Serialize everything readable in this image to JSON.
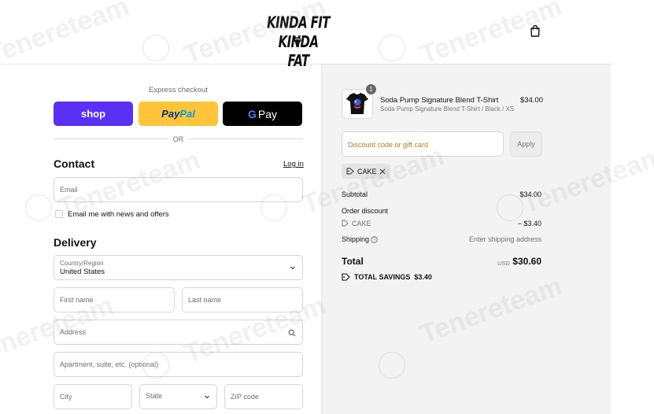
{
  "header": {
    "logo_text": "KINDA FIT KINDA FAT",
    "cart_icon": "shopping-bag-icon"
  },
  "express": {
    "title": "Express checkout",
    "shop_label": "shop",
    "paypal_label_1": "Pay",
    "paypal_label_2": "Pal",
    "gpay_g": "G",
    "gpay_label": "Pay",
    "or_label": "OR"
  },
  "contact": {
    "title": "Contact",
    "login_label": "Log in",
    "email_placeholder": "Email",
    "newsletter_label": "Email me with news and offers"
  },
  "delivery": {
    "title": "Delivery",
    "country_label": "Country/Region",
    "country_value": "United States",
    "first_name_placeholder": "First name",
    "last_name_placeholder": "Last name",
    "address_placeholder": "Address",
    "apartment_placeholder": "Apartment, suite, etc. (optional)",
    "city_placeholder": "City",
    "state_placeholder": "State",
    "zip_placeholder": "ZIP code"
  },
  "summary": {
    "product": {
      "quantity": "1",
      "name": "Soda Pump Signature Blend T-Shirt",
      "variant": "Soda Pump Signature Blend T-Shirt / Black / XS",
      "price": "$34.00"
    },
    "discount_placeholder": "Discount code or gift card",
    "apply_label": "Apply",
    "applied_code": "CAKE",
    "subtotal_label": "Subtotal",
    "subtotal_value": "$34.00",
    "order_discount_label": "Order discount",
    "discount_code": "CAKE",
    "discount_value": "− $3.40",
    "shipping_label": "Shipping",
    "shipping_value": "Enter shipping address",
    "total_label": "Total",
    "currency": "USD",
    "total_value": "$30.60",
    "savings_label": "TOTAL SAVINGS",
    "savings_value": "$3.40"
  },
  "watermark": {
    "text": "Tenereteam"
  },
  "colors": {
    "shop_brand": "#5a31f4",
    "paypal_brand": "#ffc439",
    "gpay_brand": "#000000",
    "summary_bg": "#f3f3f3",
    "discount_placeholder": "#b07d1a"
  }
}
